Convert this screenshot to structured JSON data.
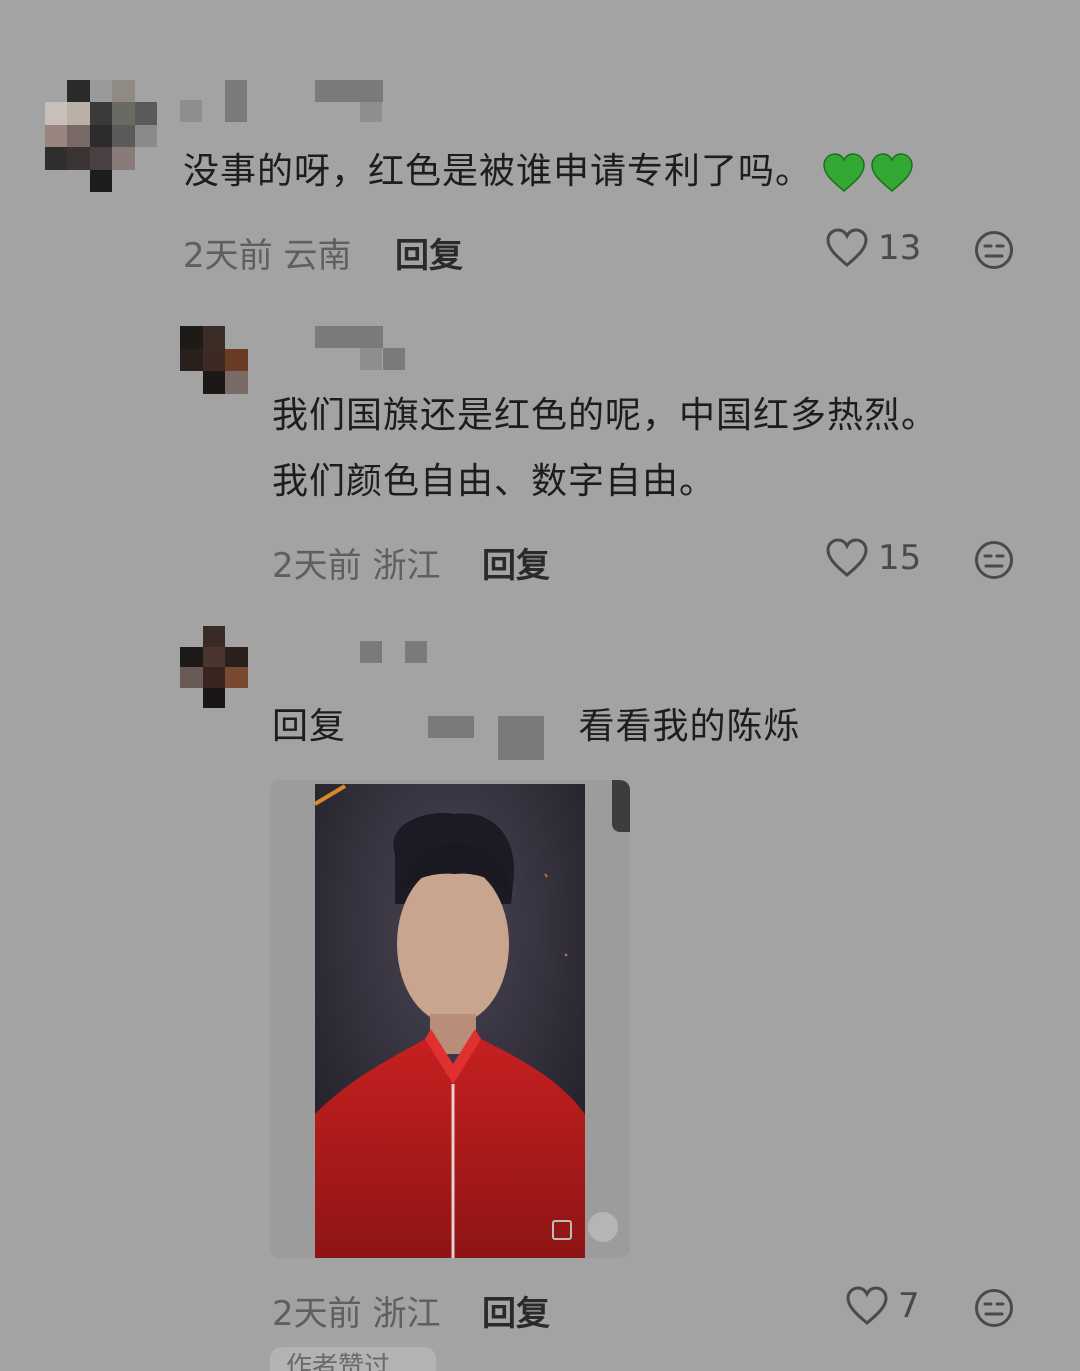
{
  "comments": [
    {
      "text": "没事的呀，红色是被谁申请专利了吗。",
      "time": "2天前",
      "location": "云南",
      "reply_label": "回复",
      "likes": "13"
    },
    {
      "text_line1": "我们国旗还是红色的呢，中国红多热烈。",
      "text_line2": "我们颜色自由、数字自由。",
      "time": "2天前",
      "location": "浙江",
      "reply_label": "回复",
      "likes": "15"
    },
    {
      "reply_prefix": "回复",
      "text": "看看我的陈烁",
      "time": "2天前",
      "location": "浙江",
      "reply_label": "回复",
      "likes": "7"
    }
  ],
  "bottom_tag": "作者赞过",
  "colors": {
    "heart_emoji": "#33a833",
    "background": "#a3a3a3"
  },
  "icons": [
    "heart-outline-icon",
    "dislike-face-icon",
    "green-heart-emoji"
  ]
}
